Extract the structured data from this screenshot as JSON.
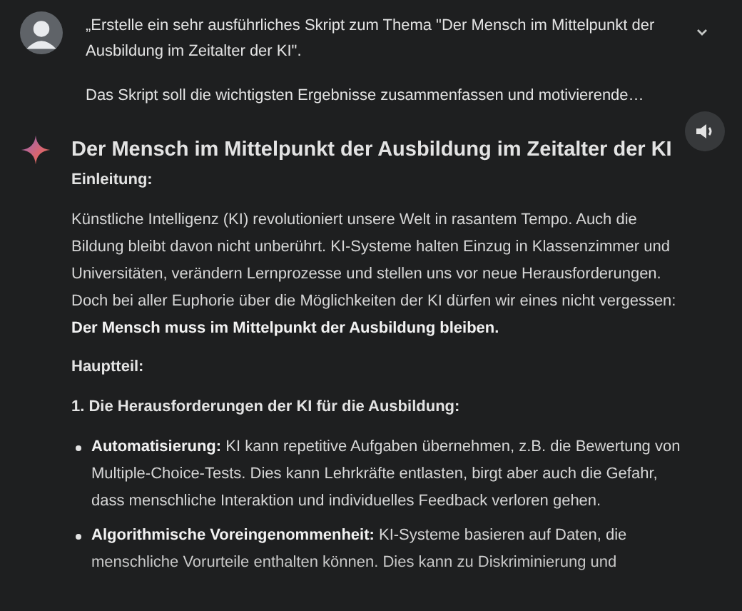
{
  "prompt": {
    "paragraphs": [
      "„Erstelle ein sehr ausführliches Skript zum Thema \"Der Mensch im Mittelpunkt der Ausbildung im Zeitalter der KI\".",
      "Das Skript soll die wichtigsten Ergebnisse zusammenfassen und motivierende…"
    ],
    "expanded": false
  },
  "response": {
    "title": "Der Mensch im Mittelpunkt der Ausbildung im Zeitalter der KI",
    "blocks": [
      {
        "kind": "heading",
        "text": "Einleitung:"
      },
      {
        "kind": "paragraph",
        "text": "Künstliche Intelligenz (KI) revolutioniert unsere Welt in rasantem Tempo. Auch die Bildung bleibt davon nicht unberührt. KI-Systeme halten Einzug in Klassenzimmer und Universitäten, verändern Lernprozesse und stellen uns vor neue Herausforderungen. Doch bei aller Euphorie über die Möglichkeiten der KI dürfen wir eines nicht vergessen: **Der Mensch muss im Mittelpunkt der Ausbildung bleiben.**"
      },
      {
        "kind": "heading",
        "text": "Hauptteil:"
      },
      {
        "kind": "heading",
        "text": "1. Die Herausforderungen der KI für die Ausbildung:"
      },
      {
        "kind": "bullet",
        "text": "**Automatisierung:** KI kann repetitive Aufgaben übernehmen, z.B. die Bewertung von Multiple-Choice-Tests. Dies kann Lehrkräfte entlasten, birgt aber auch die Gefahr, dass menschliche Interaktion und individuelles Feedback verloren gehen."
      },
      {
        "kind": "bullet",
        "text": "**Algorithmische Voreingenommenheit:** KI-Systeme basieren auf Daten, die menschliche Vorurteile enthalten können. Dies kann zu Diskriminierung und"
      }
    ]
  }
}
